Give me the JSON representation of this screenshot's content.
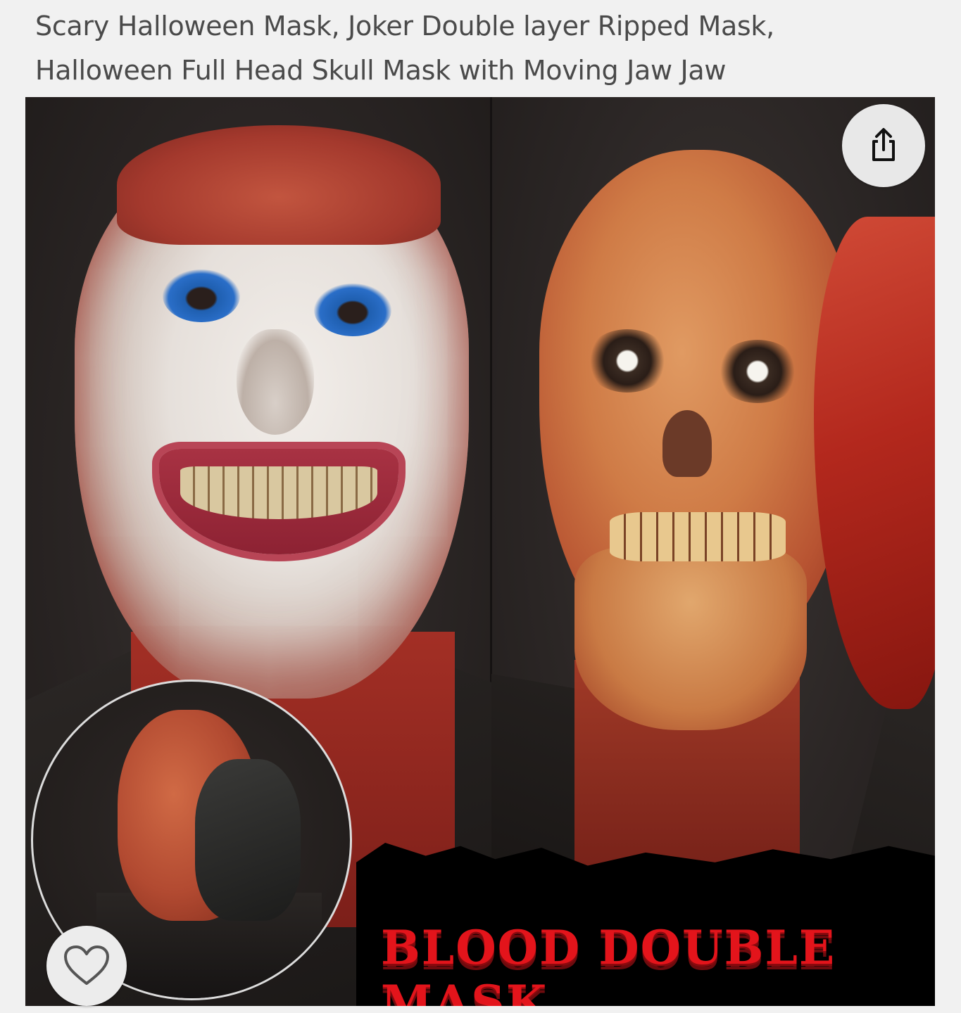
{
  "product": {
    "title_line1": "Scary Halloween Mask, Joker Double layer Ripped Mask,",
    "title_line2": "Halloween Full Head Skull Mask with Moving Jaw Jaw"
  },
  "image": {
    "banner_line1": "BLOOD DOUBLE",
    "banner_line2": "MASK",
    "banner_color": "#e3141b"
  },
  "actions": {
    "share_icon": "share-icon",
    "favorite_icon": "heart-icon"
  }
}
